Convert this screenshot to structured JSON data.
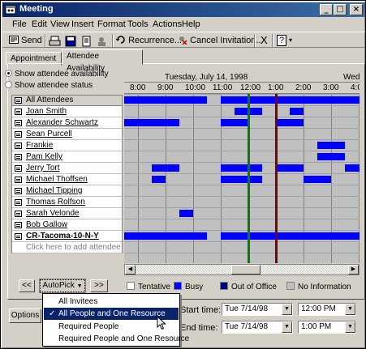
{
  "window": {
    "title": "Meeting",
    "controls": [
      "_",
      "□",
      "×"
    ]
  },
  "menu": [
    "File",
    "Edit",
    "View",
    "Insert",
    "Format",
    "Tools",
    "Actions",
    "Help"
  ],
  "toolbar": {
    "send": "Send",
    "recurrence": "Recurrence...",
    "cancel_invitation": "Cancel Invitation...",
    "delete_glyph": "X",
    "help_glyph": "?"
  },
  "tabs": {
    "appointment": "Appointment",
    "attendee_availability": "Attendee Availability"
  },
  "options": {
    "show_availability": "Show attendee availability",
    "show_status": "Show attendee status"
  },
  "attendees": {
    "header": "All Attendees",
    "rows": [
      "Joan Smith",
      "Alexander Schwartz",
      "Sean Purcell",
      "Frankie",
      "Pam Kelly",
      "Jerry Tort",
      "Michael Thoffsen",
      "Michael Tipping",
      "Thomas Rolfson",
      "Sarah Velonde",
      "Bob Gallow"
    ],
    "resource": "CR-Tacoma-10-N-Y",
    "add_placeholder": "Click here to add attendee"
  },
  "schedule": {
    "date_label": "Tuesday, July 14, 1998",
    "next_day_label": "Wed",
    "times": [
      "8:00",
      "9:00",
      "10:00",
      "11:00",
      "12:00",
      "1:00",
      "2:00",
      "3:00",
      "4:00"
    ],
    "start_marker_color": "#008000",
    "end_marker_color": "#800000",
    "busy_color": "#0000ff",
    "busy_blocks": [
      {
        "row": 0,
        "from": 7.5,
        "to": 10.5
      },
      {
        "row": 0,
        "from": 11.0,
        "to": 17.0
      },
      {
        "row": 1,
        "from": 11.5,
        "to": 12.5
      },
      {
        "row": 1,
        "from": 13.5,
        "to": 14.0
      },
      {
        "row": 2,
        "from": 7.5,
        "to": 9.5
      },
      {
        "row": 2,
        "from": 11.0,
        "to": 12.0
      },
      {
        "row": 2,
        "from": 13.0,
        "to": 14.0
      },
      {
        "row": 4,
        "from": 14.5,
        "to": 15.5
      },
      {
        "row": 5,
        "from": 14.5,
        "to": 15.5
      },
      {
        "row": 5,
        "from": 16.5,
        "to": 17.5
      },
      {
        "row": 6,
        "from": 8.5,
        "to": 9.5
      },
      {
        "row": 6,
        "from": 11.0,
        "to": 12.5
      },
      {
        "row": 6,
        "from": 13.0,
        "to": 14.0
      },
      {
        "row": 6,
        "from": 15.5,
        "to": 16.5
      },
      {
        "row": 6,
        "from": 16.8,
        "to": 17.5
      },
      {
        "row": 7,
        "from": 8.5,
        "to": 9.0
      },
      {
        "row": 7,
        "from": 11.0,
        "to": 12.5
      },
      {
        "row": 7,
        "from": 14.0,
        "to": 15.0
      },
      {
        "row": 7,
        "from": 16.5,
        "to": 17.5
      },
      {
        "row": 8,
        "from": 17.0,
        "to": 17.5
      },
      {
        "row": 10,
        "from": 9.5,
        "to": 10.0
      },
      {
        "row": 12,
        "from": 7.5,
        "to": 10.5
      },
      {
        "row": 12,
        "from": 11.0,
        "to": 17.5
      }
    ]
  },
  "nav": {
    "prev": "<<",
    "autopick": "AutoPick",
    "next": ">>",
    "options": "Options"
  },
  "legend": {
    "tentative": "Tentative",
    "busy": "Busy",
    "out_of_office": "Out of Office",
    "no_information": "No Information",
    "colors": {
      "tentative": "#ffffff",
      "busy": "#0000ff",
      "out_of_office": "#000080",
      "no_information": "#c0c0c0"
    }
  },
  "times_panel": {
    "start_label": "Start time:",
    "end_label": "End time:",
    "start_date": "Tue 7/14/98",
    "start_time": "12:00 PM",
    "end_date": "Tue 7/14/98",
    "end_time": "1:00 PM"
  },
  "autopick_menu": [
    {
      "label": "All Invitees",
      "checked": false,
      "selected": false
    },
    {
      "label": "All People and One Resource",
      "checked": true,
      "selected": true
    },
    {
      "label": "Required People",
      "checked": false,
      "selected": false
    },
    {
      "label": "Required People and One Resource",
      "checked": false,
      "selected": false
    }
  ]
}
